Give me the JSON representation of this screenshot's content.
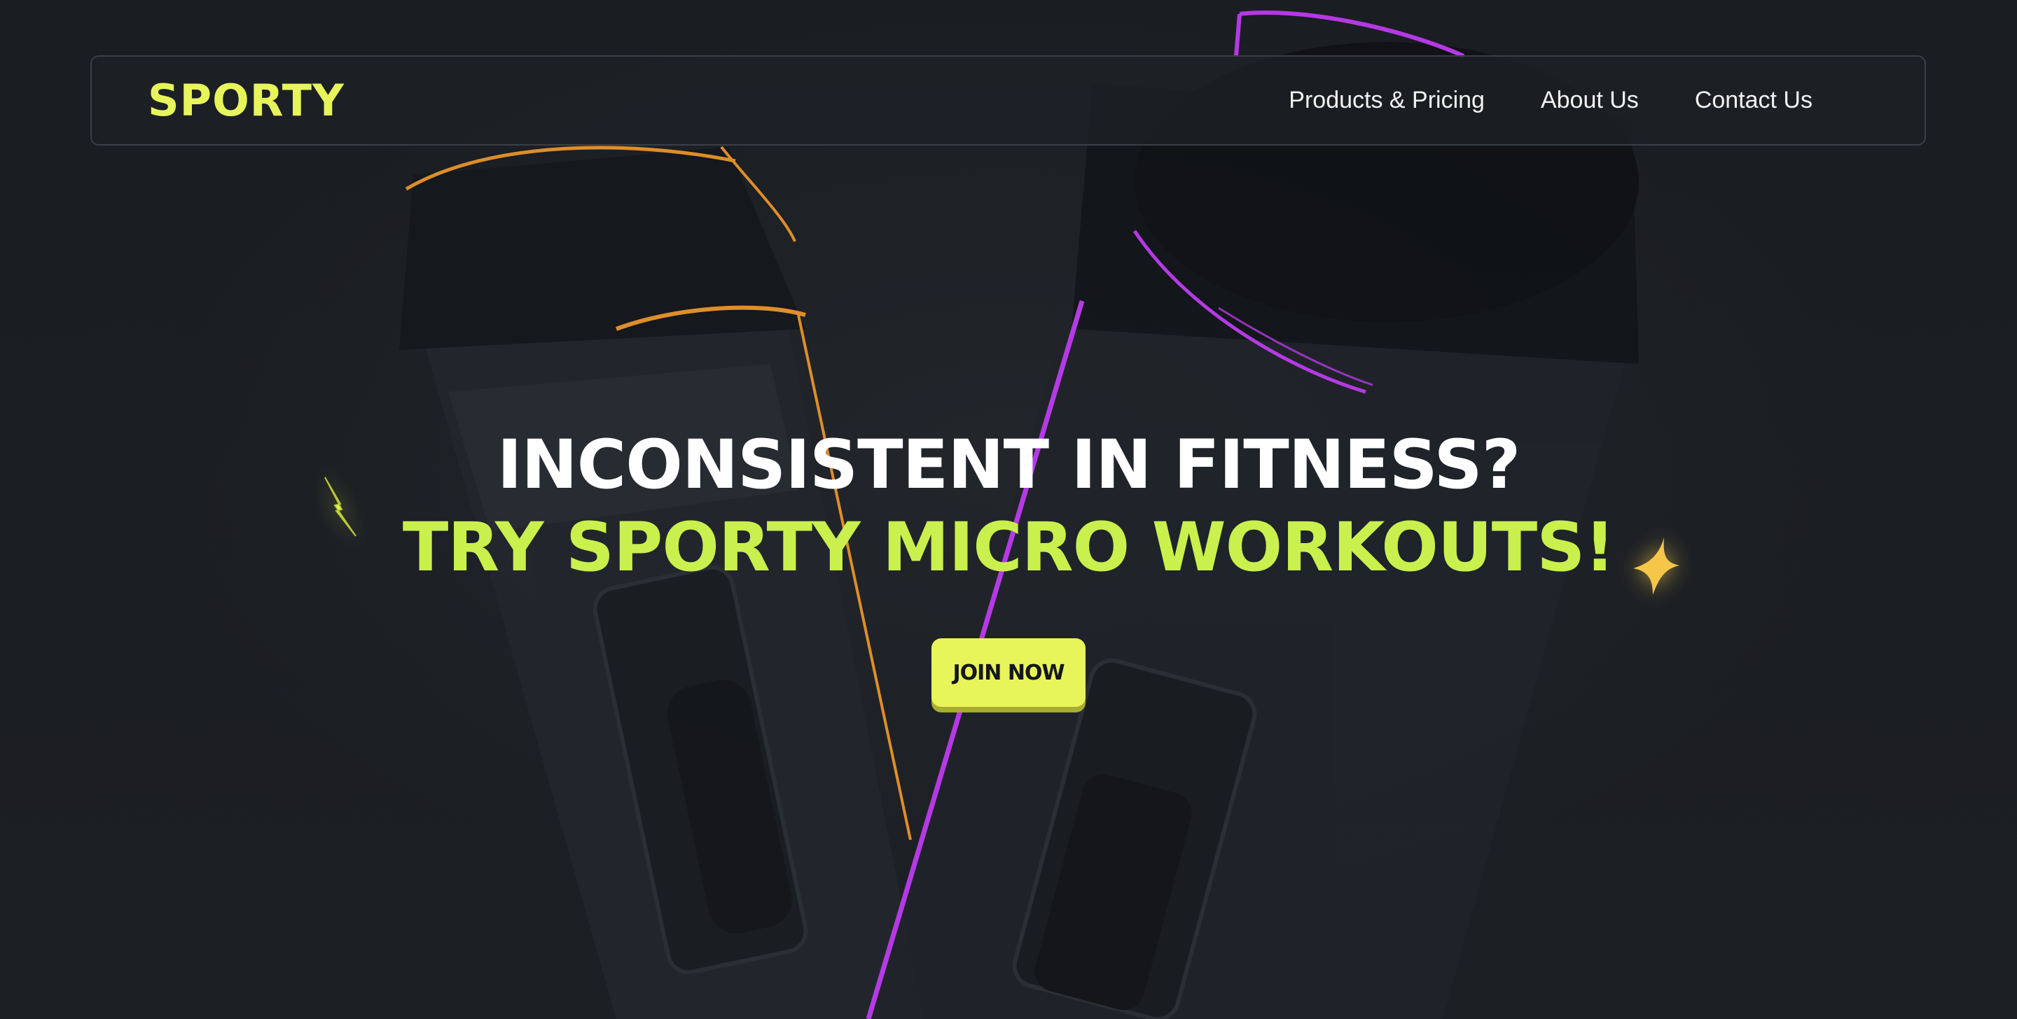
{
  "brand": {
    "logo_text": "SPORTY"
  },
  "nav": {
    "items": [
      {
        "label": "Products & Pricing"
      },
      {
        "label": "About Us"
      },
      {
        "label": "Contact Us"
      }
    ]
  },
  "hero": {
    "headline_line1": "INCONSISTENT IN FITNESS?",
    "headline_line2": "TRY SPORTY MICRO WORKOUTS!",
    "cta_label": "JOIN NOW"
  },
  "decorations": {
    "left_icon": "lightning-bolt-icon",
    "right_icon": "sparkle-star-icon"
  },
  "colors": {
    "background": "#1b1e22",
    "brand_yellow": "#e8f55a",
    "accent_green": "#c9f04d",
    "orange_glow": "#f39a2b",
    "purple_glow": "#c23cf5"
  }
}
